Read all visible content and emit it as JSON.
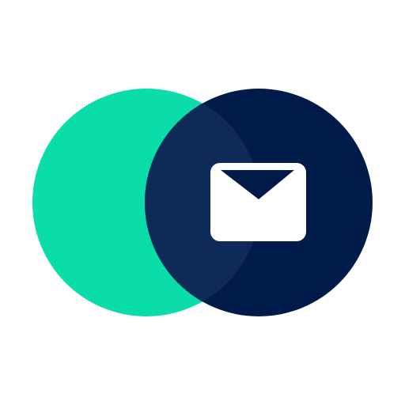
{
  "logo": {
    "icon_name": "mail-icon",
    "colors": {
      "background": "#ffffff",
      "left_circle": "#0adcaa",
      "right_circle": "#001b4a",
      "overlap": "#0e2a58",
      "envelope": "#ffffff"
    }
  }
}
